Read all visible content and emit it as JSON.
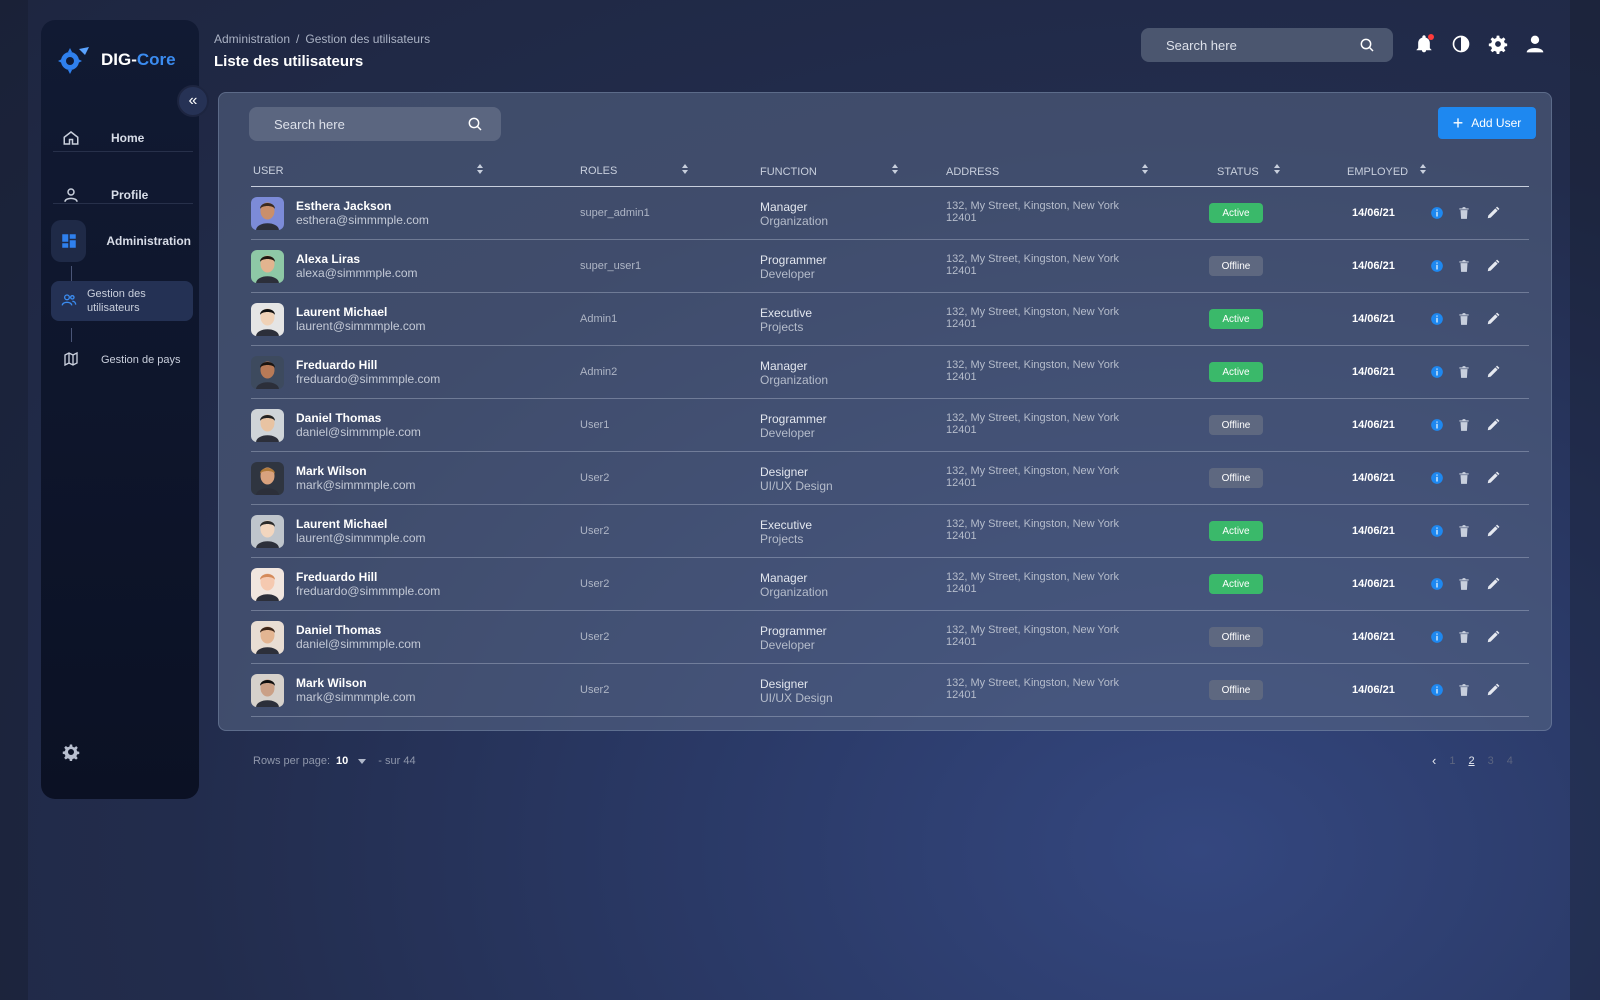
{
  "app": {
    "brand_prefix": "DIG-",
    "brand_accent": "Core"
  },
  "colors": {
    "accent": "#1e88f0",
    "active": "#3ab96a",
    "offline": "#5e6880",
    "notification": "#ff3b3b"
  },
  "sidebar": {
    "items": [
      {
        "label": "Home",
        "icon": "home-icon"
      },
      {
        "label": "Profile",
        "icon": "user-icon"
      },
      {
        "label": "Administration",
        "icon": "dashboard-icon"
      }
    ],
    "sub_items": [
      {
        "label": "Gestion des utilisateurs",
        "icon": "users-icon"
      },
      {
        "label": "Gestion de pays",
        "icon": "map-icon"
      }
    ]
  },
  "header": {
    "breadcrumb": [
      "Administration",
      "Gestion des utilisateurs"
    ],
    "title": "Liste des utilisateurs",
    "search_placeholder": "Search here"
  },
  "panel": {
    "search_placeholder": "Search here",
    "add_label": "Add User"
  },
  "table": {
    "columns": [
      "User",
      "Roles",
      "Function",
      "Address",
      "Status",
      "Employed"
    ],
    "rows": [
      {
        "name": "Esthera Jackson",
        "email": "esthera@simmmple.com",
        "role": "super_admin1",
        "func": "Manager",
        "dept": "Organization",
        "addr1": "132, My Street, Kingston, New York",
        "addr2": "12401",
        "status": "Active",
        "date": "14/06/21"
      },
      {
        "name": "Alexa Liras",
        "email": "alexa@simmmple.com",
        "role": "super_user1",
        "func": "Programmer",
        "dept": "Developer",
        "addr1": "132, My Street, Kingston, New York",
        "addr2": "12401",
        "status": "Offline",
        "date": "14/06/21"
      },
      {
        "name": "Laurent Michael",
        "email": "laurent@simmmple.com",
        "role": "Admin1",
        "func": "Executive",
        "dept": "Projects",
        "addr1": "132, My Street, Kingston, New York",
        "addr2": "12401",
        "status": "Active",
        "date": "14/06/21"
      },
      {
        "name": "Freduardo Hill",
        "email": "freduardo@simmmple.com",
        "role": "Admin2",
        "func": "Manager",
        "dept": "Organization",
        "addr1": "132, My Street, Kingston, New York",
        "addr2": "12401",
        "status": "Active",
        "date": "14/06/21"
      },
      {
        "name": "Daniel Thomas",
        "email": "daniel@simmmple.com",
        "role": "User1",
        "func": "Programmer",
        "dept": "Developer",
        "addr1": "132, My Street, Kingston, New York",
        "addr2": "12401",
        "status": "Offline",
        "date": "14/06/21"
      },
      {
        "name": "Mark Wilson",
        "email": "mark@simmmple.com",
        "role": "User2",
        "func": "Designer",
        "dept": "UI/UX Design",
        "addr1": "132, My Street, Kingston, New York",
        "addr2": "12401",
        "status": "Offline",
        "date": "14/06/21"
      },
      {
        "name": "Laurent Michael",
        "email": "laurent@simmmple.com",
        "role": "User2",
        "func": "Executive",
        "dept": "Projects",
        "addr1": "132, My Street, Kingston, New York",
        "addr2": "12401",
        "status": "Active",
        "date": "14/06/21"
      },
      {
        "name": "Freduardo Hill",
        "email": "freduardo@simmmple.com",
        "role": "User2",
        "func": "Manager",
        "dept": "Organization",
        "addr1": "132, My Street, Kingston, New York",
        "addr2": "12401",
        "status": "Active",
        "date": "14/06/21"
      },
      {
        "name": "Daniel Thomas",
        "email": "daniel@simmmple.com",
        "role": "User2",
        "func": "Programmer",
        "dept": "Developer",
        "addr1": "132, My Street, Kingston, New York",
        "addr2": "12401",
        "status": "Offline",
        "date": "14/06/21"
      },
      {
        "name": "Mark Wilson",
        "email": "mark@simmmple.com",
        "role": "User2",
        "func": "Designer",
        "dept": "UI/UX Design",
        "addr1": "132, My Street, Kingston, New York",
        "addr2": "12401",
        "status": "Offline",
        "date": "14/06/21"
      }
    ]
  },
  "footer": {
    "rows_label": "Rows per page:",
    "rows_value": "10",
    "total_label": "- sur 44",
    "pages": [
      "1",
      "2",
      "3",
      "4"
    ],
    "current_page": "2"
  }
}
